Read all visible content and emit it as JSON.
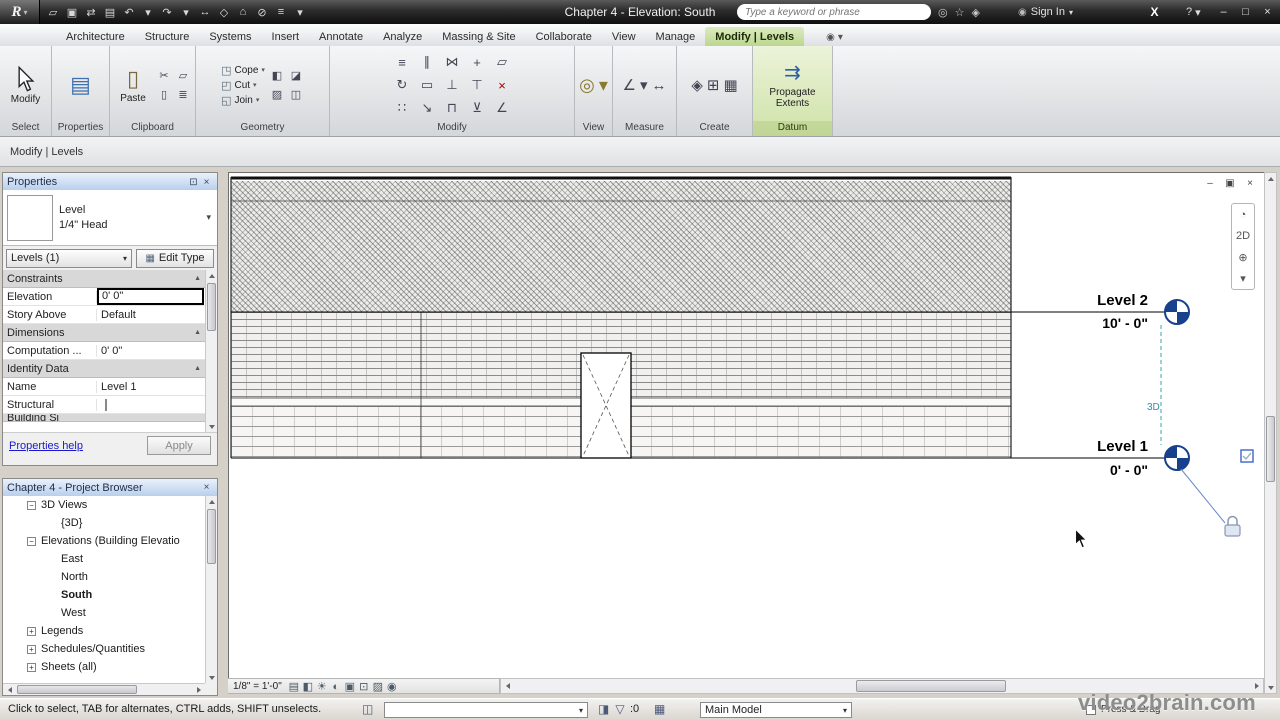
{
  "icons": {
    "dropdown": "▾",
    "close": "×",
    "minimize": "–",
    "maximize": "□",
    "dock": "⊡",
    "section_collapse": "▲",
    "help": "?",
    "app_logo": "R",
    "exchange": "X",
    "person": "◉",
    "edit_type": "▦",
    "worksets": "◫",
    "design_options": "▦"
  },
  "titlebar": {
    "title": "Chapter 4 - Elevation: South",
    "search_placeholder": "Type a keyword or phrase",
    "sign_in_label": "Sign In",
    "qat_icons": [
      {
        "name": "open-icon",
        "glyph": "▱"
      },
      {
        "name": "save-icon",
        "glyph": "▣"
      },
      {
        "name": "sync-icon",
        "glyph": "⇄"
      },
      {
        "name": "print-icon",
        "glyph": "▤"
      },
      {
        "name": "undo-icon",
        "glyph": "↶"
      },
      {
        "name": "undo-dropdown-icon",
        "glyph": "▾"
      },
      {
        "name": "redo-icon",
        "glyph": "↷"
      },
      {
        "name": "redo-dropdown-icon",
        "glyph": "▾"
      },
      {
        "name": "dimension-icon",
        "glyph": "↔"
      },
      {
        "name": "tag-icon",
        "glyph": "◇"
      },
      {
        "name": "default-3d-view-icon",
        "glyph": "⌂"
      },
      {
        "name": "section-icon",
        "glyph": "⊘"
      },
      {
        "name": "thin-lines-icon",
        "glyph": "≡"
      },
      {
        "name": "qat-customize-icon",
        "glyph": "▾"
      }
    ],
    "right_icons": [
      {
        "name": "search-go-icon",
        "glyph": "◎"
      },
      {
        "name": "subscription-center-icon",
        "glyph": "☆"
      },
      {
        "name": "communication-center-icon",
        "glyph": "◈"
      }
    ],
    "window_icons": [
      {
        "name": "window-minimize-icon",
        "glyph": "–"
      },
      {
        "name": "window-maximize-icon",
        "glyph": "□"
      },
      {
        "name": "window-close-icon",
        "glyph": "×"
      }
    ]
  },
  "ribbon": {
    "tabs": [
      {
        "label": "Architecture"
      },
      {
        "label": "Structure"
      },
      {
        "label": "Systems"
      },
      {
        "label": "Insert"
      },
      {
        "label": "Annotate"
      },
      {
        "label": "Analyze"
      },
      {
        "label": "Massing & Site"
      },
      {
        "label": "Collaborate"
      },
      {
        "label": "View"
      },
      {
        "label": "Manage"
      },
      {
        "label": "Modify | Levels",
        "active": true
      }
    ],
    "select": {
      "panel_label": "Select",
      "modify_label": "Modify"
    },
    "properties_panel": {
      "panel_label": "Properties"
    },
    "clipboard": {
      "panel_label": "Clipboard",
      "paste_label": "Paste",
      "small_icons": [
        {
          "name": "cut-to-clipboard-icon",
          "glyph": "✂"
        },
        {
          "name": "copy-to-clipboard-icon",
          "glyph": "▱"
        },
        {
          "name": "match-type-icon",
          "glyph": "▯"
        },
        {
          "name": "paste-options-icon",
          "glyph": "≣"
        }
      ]
    },
    "geometry": {
      "panel_label": "Geometry",
      "cope_label": "Cope",
      "cut_label": "Cut",
      "join_label": "Join",
      "row_icons": [
        {
          "name": "cope-icon",
          "glyph": "◳"
        },
        {
          "name": "cut-geometry-icon",
          "glyph": "◰"
        },
        {
          "name": "join-geometry-icon",
          "glyph": "◱"
        }
      ],
      "small_icons": [
        {
          "name": "paint-icon",
          "glyph": "◧"
        },
        {
          "name": "demolish-icon",
          "glyph": "◪"
        },
        {
          "name": "wall-joins-icon",
          "glyph": "▨"
        },
        {
          "name": "beam-joins-icon",
          "glyph": "◫"
        }
      ]
    },
    "modify_panel": {
      "panel_label": "Modify",
      "icons": [
        {
          "name": "align-icon",
          "glyph": "≡"
        },
        {
          "name": "offset-icon",
          "glyph": "∥"
        },
        {
          "name": "mirror-icon",
          "glyph": "⋈"
        },
        {
          "name": "move-icon",
          "glyph": "+"
        },
        {
          "name": "copy-icon",
          "glyph": "▱"
        },
        {
          "name": "rotate-icon",
          "glyph": "↻"
        },
        {
          "name": "trim-icon",
          "glyph": "▭"
        },
        {
          "name": "split-icon",
          "glyph": "⊥"
        },
        {
          "name": "pin-icon",
          "glyph": "⊤"
        },
        {
          "name": "delete-icon",
          "glyph": "×",
          "color": "#b00000"
        },
        {
          "name": "array-icon",
          "glyph": "∷"
        },
        {
          "name": "scale-icon",
          "glyph": "↘"
        },
        {
          "name": "extend-icon",
          "glyph": "⊓"
        },
        {
          "name": "unpin-icon",
          "glyph": "⊻"
        },
        {
          "name": "measure-angle-icon",
          "glyph": "∠"
        }
      ]
    },
    "view_panel": {
      "panel_label": "View",
      "icons": [
        {
          "name": "hide-in-view-icon",
          "glyph": "◎"
        },
        {
          "name": "view-dropdown-icon",
          "glyph": "▾"
        }
      ]
    },
    "measure": {
      "panel_label": "Measure",
      "icons": [
        {
          "name": "measure-icon",
          "glyph": "∠"
        },
        {
          "name": "measure-dropdown-icon",
          "glyph": "▾"
        },
        {
          "name": "aligned-dimension-icon",
          "glyph": "↔"
        }
      ]
    },
    "create": {
      "panel_label": "Create",
      "icons": [
        {
          "name": "create-group-icon",
          "glyph": "◈"
        },
        {
          "name": "create-similar-icon",
          "glyph": "⊞"
        },
        {
          "name": "create-assembly-icon",
          "glyph": "▦"
        }
      ]
    },
    "datum": {
      "panel_label": "Datum",
      "propagate_label": "Propagate Extents"
    }
  },
  "options_bar": {
    "label": "Modify | Levels"
  },
  "properties_palette": {
    "title": "Properties",
    "type_family": "Level",
    "type_name": "1/4\" Head",
    "filter_value": "Levels (1)",
    "edit_type_label": "Edit Type",
    "rows": [
      {
        "label": "Constraints"
      },
      {
        "label": "Elevation",
        "value": "0' 0\""
      },
      {
        "label": "Story Above",
        "value": "Default"
      },
      {
        "label": "Dimensions"
      },
      {
        "label": "Computation ...",
        "value": "0' 0\""
      },
      {
        "label": "Identity Data"
      },
      {
        "label": "Name",
        "value": "Level 1"
      },
      {
        "label": "Structural",
        "value": ""
      },
      {
        "label": "Building Si"
      }
    ],
    "help_link": "Properties help",
    "apply_label": "Apply",
    "header_icons": [
      {
        "name": "palette-dock-icon",
        "glyph": "⊡"
      },
      {
        "name": "palette-close-icon",
        "glyph": "×"
      }
    ]
  },
  "project_browser": {
    "title": "Chapter 4 - Project Browser",
    "items": [
      {
        "label": "3D Views",
        "exp": "−"
      },
      {
        "label": "{3D}",
        "exp": ""
      },
      {
        "label": "Elevations (Building Elevatio",
        "exp": "−"
      },
      {
        "label": "East",
        "exp": ""
      },
      {
        "label": "North",
        "exp": ""
      },
      {
        "label": "South",
        "exp": ""
      },
      {
        "label": "West",
        "exp": ""
      },
      {
        "label": "Legends",
        "exp": "+"
      },
      {
        "label": "Schedules/Quantities",
        "exp": "+"
      },
      {
        "label": "Sheets (all)",
        "exp": "+"
      }
    ]
  },
  "canvas": {
    "levels": [
      {
        "name": "Level 2",
        "elevation": "10' - 0\""
      },
      {
        "name": "Level 1",
        "elevation": "0' - 0\""
      }
    ],
    "constraint_3d": "3D",
    "view_window_icons": [
      {
        "name": "view-minimize-icon",
        "glyph": "–"
      },
      {
        "name": "view-restore-icon",
        "glyph": "▣"
      },
      {
        "name": "view-close-icon",
        "glyph": "×"
      }
    ],
    "navbar_icons": [
      {
        "name": "steering-wheel-icon",
        "glyph": "◔"
      },
      {
        "name": "wheel-2d-icon",
        "glyph": "2D"
      },
      {
        "name": "zoom-icon",
        "glyph": "⊕"
      },
      {
        "name": "zoom-dropdown-icon",
        "glyph": "▾"
      }
    ]
  },
  "view_control_bar": {
    "scale": "1/8\" = 1'-0\"",
    "icons": [
      {
        "name": "detail-level-icon",
        "glyph": "▤"
      },
      {
        "name": "visual-style-icon",
        "glyph": "◧"
      },
      {
        "name": "sun-path-icon",
        "glyph": "☀"
      },
      {
        "name": "shadows-icon",
        "glyph": "◐"
      },
      {
        "name": "crop-view-icon",
        "glyph": "▣"
      },
      {
        "name": "crop-region-icon",
        "glyph": "⊡"
      },
      {
        "name": "temporary-hide-icon",
        "glyph": "▨"
      },
      {
        "name": "reveal-hidden-icon",
        "glyph": "◉"
      }
    ]
  },
  "status_bar": {
    "hint": "Click to select, TAB for alternates, CTRL adds, SHIFT unselects.",
    "selection_count": ":0",
    "design_option_value": "Main Model",
    "press_drag_label": "Press & Drag",
    "mid_icons": [
      {
        "name": "editable-only-icon",
        "glyph": "◨"
      },
      {
        "name": "filter-icon",
        "glyph": "▽"
      }
    ]
  },
  "watermark": "video2brain.com"
}
